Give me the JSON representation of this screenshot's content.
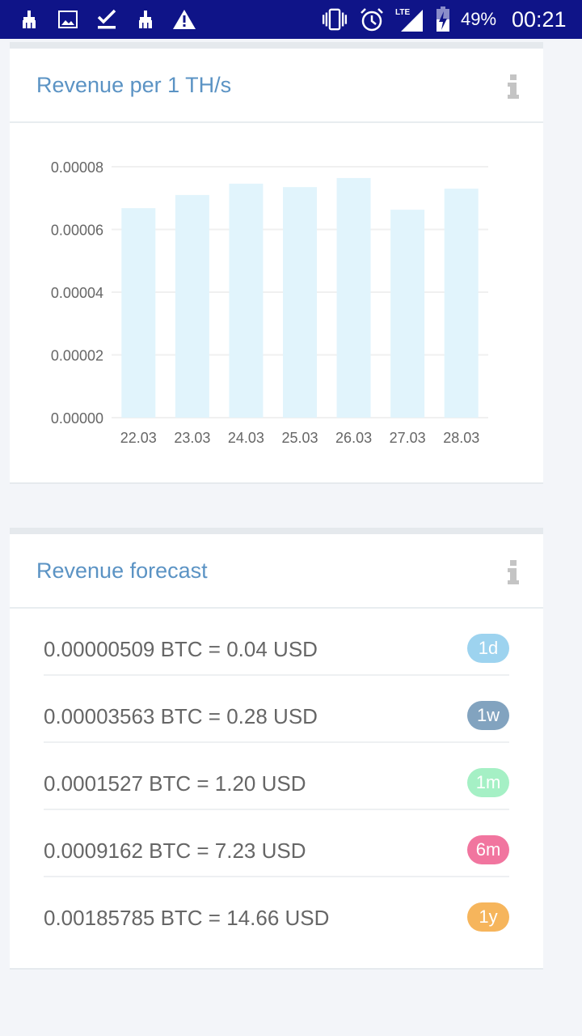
{
  "status_bar": {
    "left_icons": [
      "broom-icon",
      "image-icon",
      "download-done-icon",
      "broom-icon",
      "warning-icon"
    ],
    "right_icons": [
      "vibrate-icon",
      "alarm-icon",
      "lte-signal-icon",
      "battery-charging-icon"
    ],
    "lte_label": "LTE",
    "battery": "49%",
    "time": "00:21"
  },
  "revenue_card": {
    "title": "Revenue per 1 TH/s",
    "info_icon": "info-icon"
  },
  "chart_data": {
    "type": "bar",
    "title": "Revenue per 1 TH/s",
    "xlabel": "",
    "ylabel": "",
    "categories": [
      "22.03",
      "23.03",
      "24.03",
      "25.03",
      "26.03",
      "27.03",
      "28.03"
    ],
    "values": [
      6.68e-05,
      7.1e-05,
      7.46e-05,
      7.35e-05,
      7.64e-05,
      6.63e-05,
      7.3e-05
    ],
    "ylim": [
      0,
      8e-05
    ],
    "yticks": [
      "0.00000",
      "0.00002",
      "0.00004",
      "0.00006",
      "0.00008"
    ],
    "ytick_values": [
      0,
      2e-05,
      4e-05,
      6e-05,
      8e-05
    ],
    "grid": true,
    "bar_color": "#e1f4fc",
    "legend": "none"
  },
  "forecast_card": {
    "title": "Revenue forecast",
    "info_icon": "info-icon",
    "rows": [
      {
        "text": "0.00000509 BTC = 0.04 USD",
        "badge": "1d",
        "color": "#9dd3ef"
      },
      {
        "text": "0.00003563 BTC = 0.28 USD",
        "badge": "1w",
        "color": "#82a3bf"
      },
      {
        "text": "0.0001527 BTC = 1.20 USD",
        "badge": "1m",
        "color": "#a5f0c5"
      },
      {
        "text": "0.0009162 BTC = 7.23 USD",
        "badge": "6m",
        "color": "#f1759f"
      },
      {
        "text": "0.00185785 BTC = 14.66 USD",
        "badge": "1y",
        "color": "#f6b55c"
      }
    ]
  }
}
